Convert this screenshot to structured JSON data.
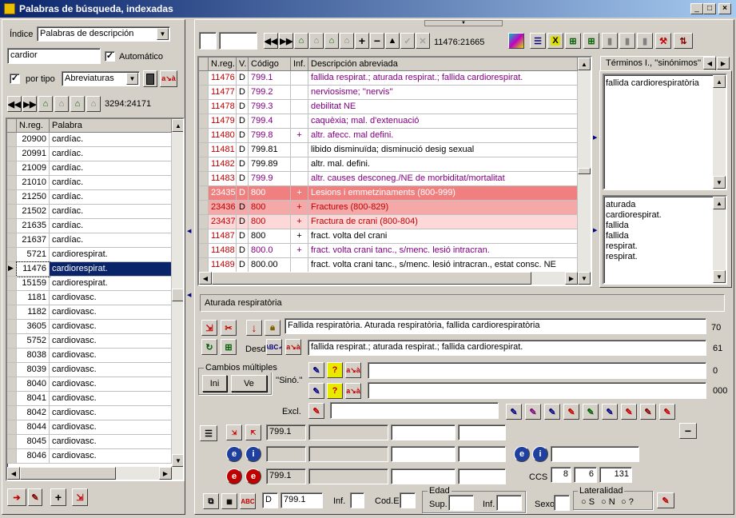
{
  "window": {
    "title": "Palabras de búsqueda, indexadas",
    "min": "_",
    "max": "□",
    "close": "×"
  },
  "left": {
    "indice_label": "Índice",
    "indice_value": "Palabras de descripción",
    "search_value": "cardior",
    "automatico_label": "Automático",
    "portipo_label": "por tipo",
    "portipo_value": "Abreviaturas",
    "nav_counter": "3294:24171",
    "cols": [
      "N.reg.",
      "Palabra"
    ],
    "rows": [
      [
        "20900",
        "cardíac."
      ],
      [
        "20991",
        "cardíac."
      ],
      [
        "21009",
        "cardíac."
      ],
      [
        "21010",
        "cardíac."
      ],
      [
        "21250",
        "cardíac."
      ],
      [
        "21502",
        "cardíac."
      ],
      [
        "21635",
        "cardíac."
      ],
      [
        "21637",
        "cardíac."
      ],
      [
        "5721",
        "cardiorespirat."
      ],
      [
        "11476",
        "cardiorespirat."
      ],
      [
        "15159",
        "cardiorespirat."
      ],
      [
        "1181",
        "cardiovasc."
      ],
      [
        "1182",
        "cardiovasc."
      ],
      [
        "3605",
        "cardiovasc."
      ],
      [
        "5752",
        "cardiovasc."
      ],
      [
        "8038",
        "cardiovasc."
      ],
      [
        "8039",
        "cardiovasc."
      ],
      [
        "8040",
        "cardiovasc."
      ],
      [
        "8041",
        "cardiovasc."
      ],
      [
        "8042",
        "cardiovasc."
      ],
      [
        "8044",
        "cardiovasc."
      ],
      [
        "8045",
        "cardiovasc."
      ],
      [
        "8046",
        "cardiovasc."
      ]
    ],
    "selected_index": 9
  },
  "right": {
    "counter": "11476:21665",
    "cols": [
      "N.reg.",
      "V.",
      "Código",
      "Inf.",
      "Descripción abreviada"
    ],
    "rows": [
      {
        "n": "11476",
        "v": "D",
        "c": "799.1",
        "i": "",
        "d": "fallida respirat.; aturada respirat.; fallida cardiorespirat.",
        "style": "purple"
      },
      {
        "n": "11477",
        "v": "D",
        "c": "799.2",
        "i": "",
        "d": "nerviosisme; ''nervis''",
        "style": "purple"
      },
      {
        "n": "11478",
        "v": "D",
        "c": "799.3",
        "i": "",
        "d": "debilitat NE",
        "style": "purple"
      },
      {
        "n": "11479",
        "v": "D",
        "c": "799.4",
        "i": "",
        "d": "caquèxia; mal. d'extenuació",
        "style": "purple"
      },
      {
        "n": "11480",
        "v": "D",
        "c": "799.8",
        "i": "+",
        "d": "altr. afecc. mal defini.",
        "style": "purple"
      },
      {
        "n": "11481",
        "v": "D",
        "c": "799.81",
        "i": "",
        "d": "libido disminuïda; disminució desig sexual",
        "style": "black"
      },
      {
        "n": "11482",
        "v": "D",
        "c": "799.89",
        "i": "",
        "d": "altr. mal. defini.",
        "style": "black"
      },
      {
        "n": "11483",
        "v": "D",
        "c": "799.9",
        "i": "",
        "d": "altr. causes desconeg./NE de morbiditat/mortalitat",
        "style": "purple"
      },
      {
        "n": "23435",
        "v": "D",
        "c": "800",
        "i": "+",
        "d": "Lesions i emmetzinaments (800-999)",
        "style": "hi1"
      },
      {
        "n": "23436",
        "v": "D",
        "c": "800",
        "i": "+",
        "d": "Fractures (800-829)",
        "style": "hi2"
      },
      {
        "n": "23437",
        "v": "D",
        "c": "800",
        "i": "+",
        "d": "Fractura de crani (800-804)",
        "style": "hi3"
      },
      {
        "n": "11487",
        "v": "D",
        "c": "800",
        "i": "+",
        "d": "fract. volta del crani",
        "style": "black"
      },
      {
        "n": "11488",
        "v": "D",
        "c": "800.0",
        "i": "+",
        "d": "fract. volta crani tanc., s/menc. lesió intracran.",
        "style": "purple"
      },
      {
        "n": "11489",
        "v": "D",
        "c": "800.00",
        "i": "",
        "d": "fract. volta crani tanc., s/menc. lesió intracran., estat consc. NE",
        "style": "black"
      }
    ],
    "terms_tab": "Términos I., ''sinónimos''",
    "terms_top": "fallida cardiorespiratòria",
    "terms_list": [
      "aturada",
      "cardiorespirat.",
      "fallida",
      "fallida",
      "respirat.",
      "respirat."
    ],
    "status_text": "Aturada respiratòria",
    "full_desc": "Fallida respiratòria. Aturada respiratòria, fallida cardiorespiratòria",
    "full_desc_len": "70",
    "desd_label": "Desd",
    "abbr_desc": "fallida respirat.; aturada respirat.; fallida cardiorespirat.",
    "abbr_desc_len": "61",
    "cambios_label": "Cambios múltiples",
    "ini_label": "Ini",
    "ve_label": "Ve",
    "sino_label": "''Sinó.''",
    "sino1_len": "0",
    "sino2_len": "000",
    "excl_label": "Excl.",
    "code_a": "799.1",
    "code_b": "799.1",
    "ccs_label": "CCS",
    "ccs1": "8",
    "ccs2": "6",
    "ccs3": "131",
    "minus_label": "−",
    "bottom_v": "D",
    "bottom_code": "799.1",
    "inf_label": "Inf.",
    "code_e_label": "Cod.E",
    "edad_label": "Edad",
    "sup_label": "Sup.",
    "inf2_label": "Inf.",
    "sexo_label": "Sexo",
    "lateralidad_label": "Lateralidad",
    "lat_options": [
      "S",
      "N",
      "?"
    ]
  }
}
